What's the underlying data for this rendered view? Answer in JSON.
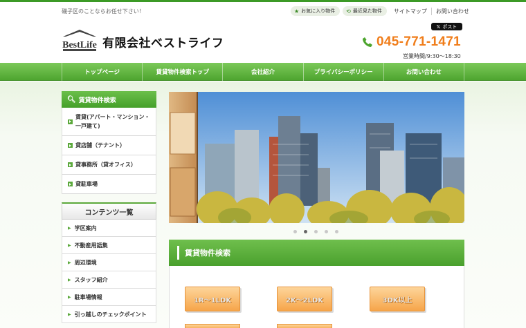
{
  "header": {
    "tagline": "磯子区のことならお任せ下さい！",
    "favorites": "お気に入り物件",
    "recent": "最近見た物件",
    "sitemap": "サイトマップ",
    "contact": "お問い合わせ",
    "company": "有限会社ベストライフ",
    "logo_text": "BestLife",
    "xpost": "ポスト",
    "phone": "045-771-1471",
    "hours": "営業時間/9:30～18:30"
  },
  "nav": [
    "トップページ",
    "賃貸物件検索トップ",
    "会社紹介",
    "プライバシーポリシー",
    "お問い合わせ"
  ],
  "sidebar": {
    "search_title": "賃貸物件検索",
    "search_items": [
      "賃貸(アパート・マンション・一戸建て)",
      "貸店舗（テナント）",
      "貸事務所（貸オフィス）",
      "貸駐車場"
    ],
    "contents_title": "コンテンツ一覧",
    "contents_items": [
      "学区案内",
      "不動産用語集",
      "周辺環境",
      "スタッフ紹介",
      "駐車場情報",
      "引っ越しのチェックポイント"
    ]
  },
  "slider": {
    "active_index": 1,
    "count": 5
  },
  "section": {
    "title": "賃貸物件検索",
    "buttons": [
      "1R～1LDK",
      "2K～2LDK",
      "3DK以上"
    ]
  },
  "colors": {
    "brand_green": "#4ea52f",
    "accent_orange": "#f07d1a"
  }
}
